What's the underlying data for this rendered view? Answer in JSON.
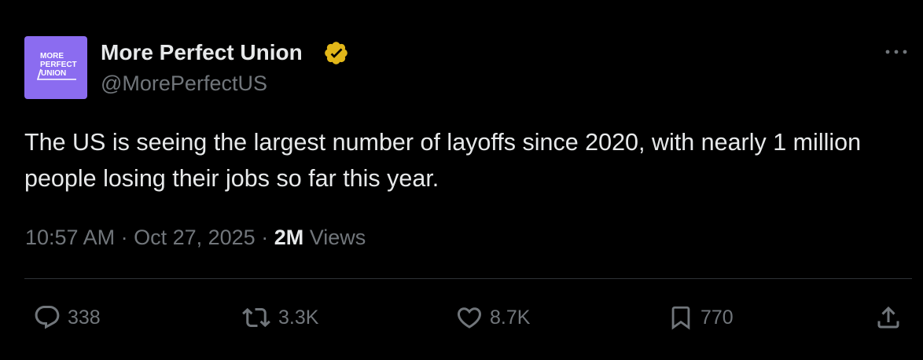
{
  "author": {
    "avatar_text": [
      "MORE",
      "PERFECT",
      "UNION"
    ],
    "display_name": "More Perfect Union",
    "handle": "@MorePerfectUS",
    "verified_icon": "verified-badge-icon"
  },
  "tweet": {
    "text": "The US is seeing the largest number of layoffs since 2020, with nearly 1 million people losing their jobs so far this year.",
    "time": "10:57 AM",
    "date": "Oct 27, 2025",
    "separator": " · ",
    "views_count": "2M",
    "views_label": " Views"
  },
  "actions": {
    "replies": "338",
    "reposts": "3.3K",
    "likes": "8.7K",
    "bookmarks": "770"
  },
  "colors": {
    "background": "#000000",
    "text": "#e7e9ea",
    "secondary": "#71767b",
    "divider": "#2f3336",
    "verified": "#e2b719",
    "avatar": "#8b6cf0"
  }
}
